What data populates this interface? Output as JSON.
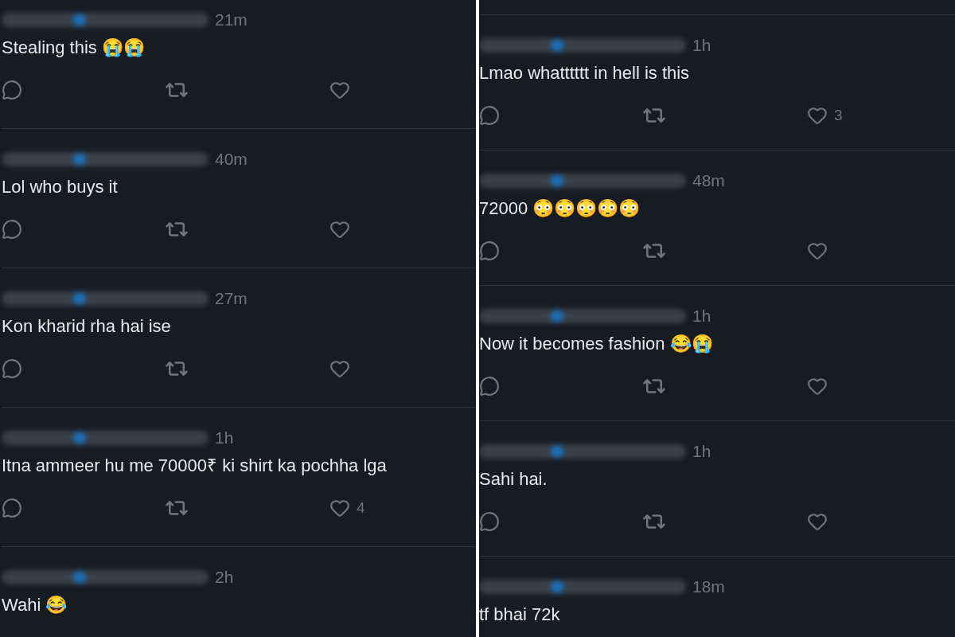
{
  "columns": [
    {
      "replies": [
        {
          "time": "21m",
          "text": "Stealing this 😭😭"
        },
        {
          "time": "40m",
          "text": "Lol who buys it"
        },
        {
          "time": "27m",
          "text": "Kon kharid rha hai ise"
        },
        {
          "time": "1h",
          "text": "Itna ammeer hu me 70000₹ ki shirt ka pochha lga",
          "likes": "4"
        },
        {
          "time": "2h",
          "text": "Wahi 😂"
        }
      ]
    },
    {
      "replies": [
        {
          "time": "1h",
          "text": "Lmao whatttttt in hell is this",
          "likes": "3"
        },
        {
          "time": "48m",
          "text": "72000 😳😳😳😳😳"
        },
        {
          "time": "1h",
          "text": "Now it becomes fashion 😂😭"
        },
        {
          "time": "1h",
          "text": "Sahi hai."
        },
        {
          "time": "18m",
          "text": "tf bhai 72k"
        }
      ]
    }
  ]
}
